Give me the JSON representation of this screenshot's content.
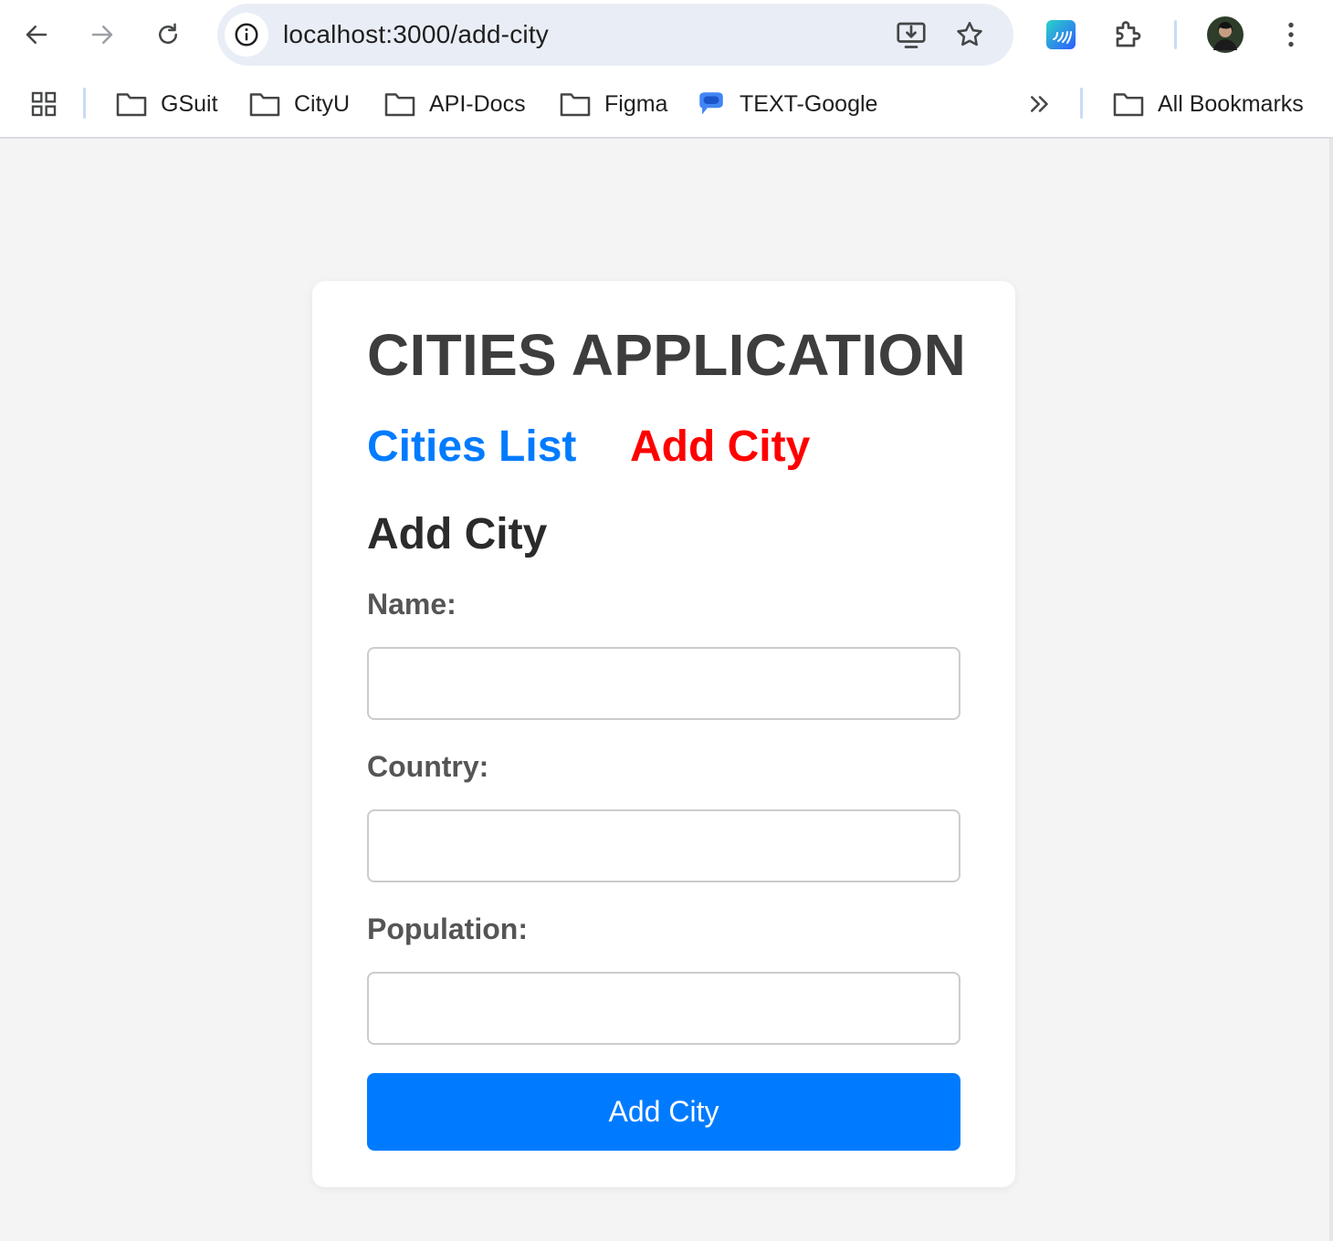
{
  "browser": {
    "url": "localhost:3000/add-city",
    "icons": {
      "back": "back-arrow-icon",
      "forward": "forward-arrow-icon",
      "reload": "reload-icon",
      "site_info": "info-icon",
      "install": "install-app-icon",
      "bookmark": "star-icon",
      "extension_app": "nfc-extension-icon",
      "extensions": "puzzle-icon",
      "profile": "avatar",
      "menu": "kebab-menu-icon"
    },
    "bookmarks": [
      {
        "label": "GSuit",
        "icon": "folder-icon"
      },
      {
        "label": "CityU",
        "icon": "folder-icon"
      },
      {
        "label": "API-Docs",
        "icon": "folder-icon"
      },
      {
        "label": "Figma",
        "icon": "folder-icon"
      },
      {
        "label": "TEXT-Google",
        "icon": "messages-icon"
      }
    ],
    "all_bookmarks": "All Bookmarks"
  },
  "app": {
    "title": "CITIES APPLICATION",
    "nav": {
      "cities_list": "Cities List",
      "add_city": "Add City"
    },
    "form": {
      "heading": "Add City",
      "fields": [
        {
          "label": "Name:",
          "value": ""
        },
        {
          "label": "Country:",
          "value": ""
        },
        {
          "label": "Population:",
          "value": ""
        }
      ],
      "submit_label": "Add City"
    }
  },
  "colors": {
    "link_blue": "#007bff",
    "active_red": "#ff0000",
    "button_blue": "#007bff",
    "page_bg": "#f4f4f4"
  }
}
